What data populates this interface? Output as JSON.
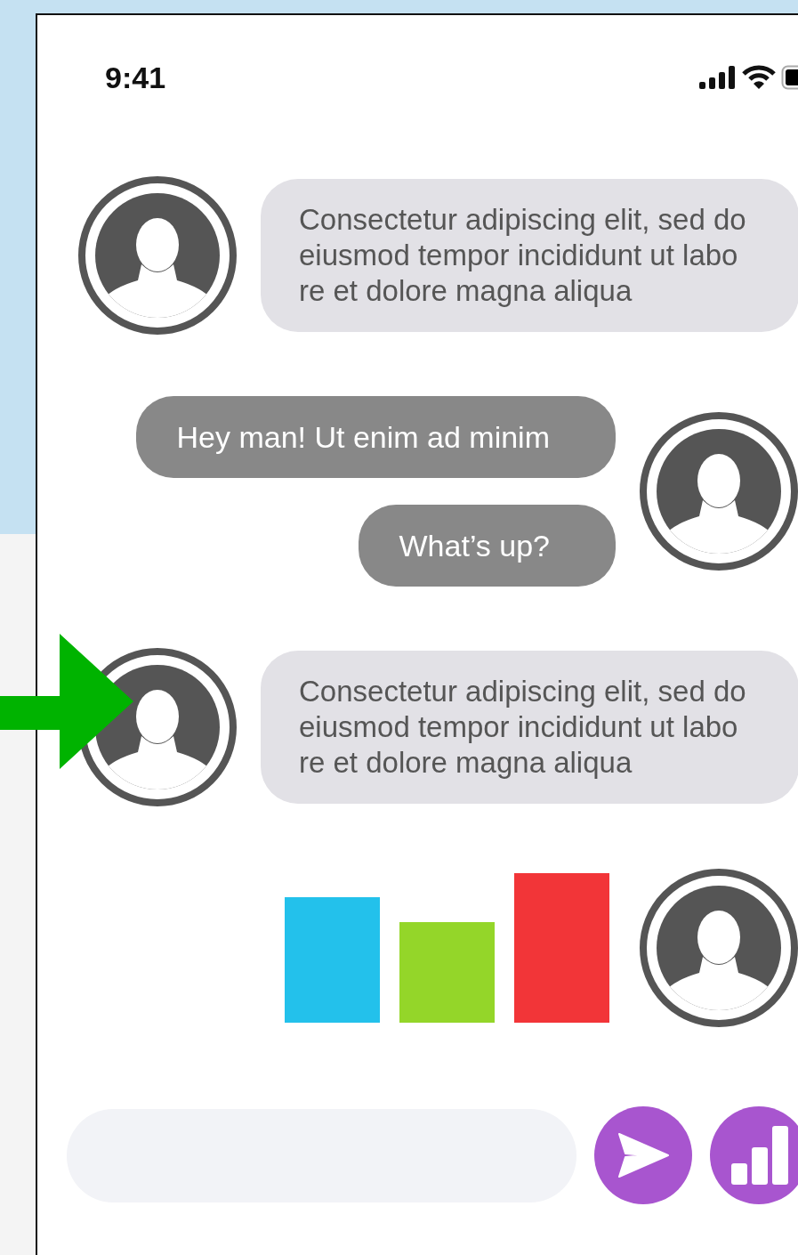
{
  "status_bar": {
    "time": "9:41"
  },
  "messages": [
    {
      "kind": "incoming",
      "pointed": false,
      "bubbles": [
        "Consectetur adipiscing elit, sed do\neiusmod tempor incididunt ut labo\nre et dolore magna aliqua"
      ]
    },
    {
      "kind": "outgoing",
      "pointed": false,
      "bubbles": [
        "Hey man! Ut enim ad minim",
        "What’s up?"
      ]
    },
    {
      "kind": "incoming",
      "pointed": true,
      "bubbles": [
        "Consectetur adipiscing elit, sed do\neiusmod tempor incididunt ut labo\nre et dolore magna aliqua"
      ]
    },
    {
      "kind": "chart",
      "pointed": false
    }
  ]
}
